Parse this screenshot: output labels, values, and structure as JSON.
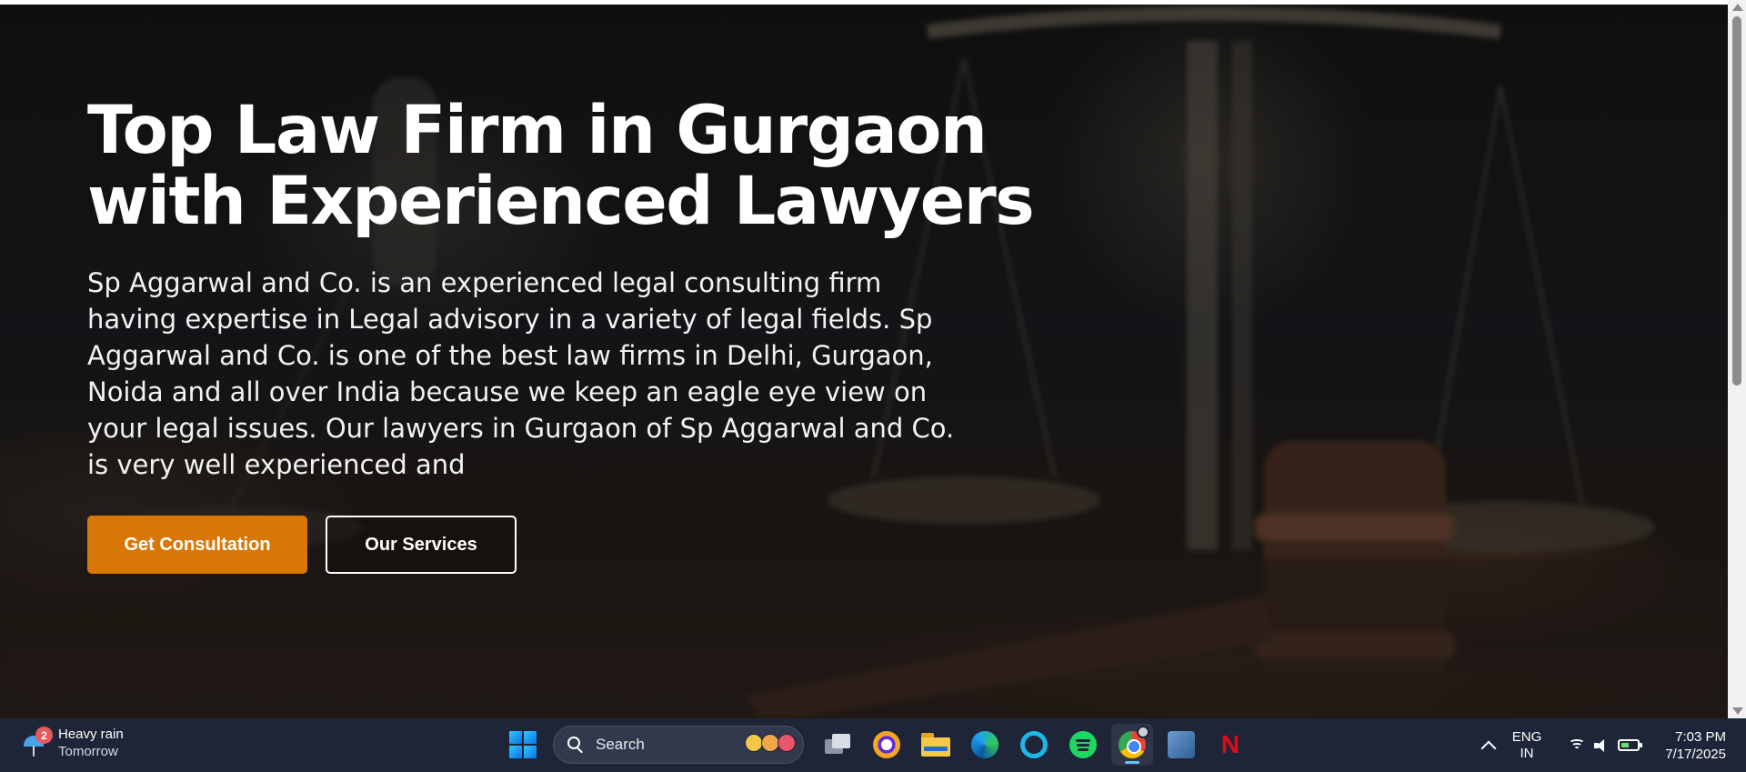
{
  "hero": {
    "title": "Top Law Firm in Gurgaon with Experienced Lawyers",
    "description": "Sp Aggarwal and Co. is an experienced legal consulting firm having expertise in Legal advisory in a variety of legal fields. Sp Aggarwal and Co. is one of the best law firms in Delhi, Gurgaon, Noida and all over India because we keep an eagle eye view on your legal issues. Our lawyers in Gurgaon of Sp Aggarwal and Co. is very well experienced and",
    "primary_button": "Get Consultation",
    "secondary_button": "Our Services",
    "accent_color": "#d97706"
  },
  "taskbar": {
    "weather": {
      "badge": "2",
      "condition": "Heavy rain",
      "when": "Tomorrow",
      "icon": "umbrella-rain-icon"
    },
    "search_label": "Search",
    "pinned": [
      "task-view-icon",
      "brave-icon",
      "file-explorer-icon",
      "edge-icon",
      "alexa-icon",
      "spotify-icon",
      "chrome-icon",
      "mysql-workbench-icon",
      "netflix-icon"
    ],
    "netflix_glyph": "N",
    "language": {
      "line1": "ENG",
      "line2": "IN"
    },
    "clock": {
      "time": "7:03 PM",
      "date": "7/17/2025"
    }
  }
}
